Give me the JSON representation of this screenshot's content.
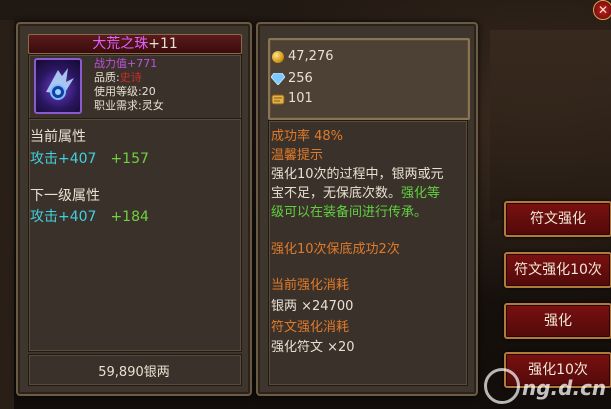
{
  "item": {
    "name": "大荒之珠",
    "level": "+11",
    "power": "战力值+771",
    "quality_label": "品质:",
    "quality_value": "史诗",
    "use_level": "使用等级:20",
    "class_req": "职业需求:灵女"
  },
  "current_attrs": {
    "title": "当前属性",
    "attack": "攻击+407",
    "bonus": "+157"
  },
  "next_attrs": {
    "title": "下一级属性",
    "attack": "攻击+407",
    "bonus": "+184"
  },
  "cost_silver": "59,890银两",
  "resources": {
    "gold": "47,276",
    "diamond": "256",
    "scroll": "101"
  },
  "info": {
    "success_rate": "成功率 48%",
    "tip_title": "温馨提示",
    "tip_line1": "强化10次的过程中，银两或元",
    "tip_line2a": "宝不足，无保底次数。",
    "tip_line2b": "强化等",
    "tip_line3": "级可以在装备间进行传承。",
    "guarantee": "强化10次保底成功2次",
    "consume_title": "当前强化消耗",
    "silver_cost": "银两 ×24700",
    "rune_title": "符文强化消耗",
    "rune_cost": "强化符文 ×20"
  },
  "buttons": {
    "rune_enhance": "符文强化",
    "rune_enhance_10": "符文强化10次",
    "enhance": "强化",
    "enhance_10": "强化10次"
  },
  "close": "✕",
  "watermark": "ng.d.cn",
  "colors": {
    "panel": "#3e352c",
    "button": "#6a0e0e",
    "orange_text": "#e07a2a",
    "green_text": "#60d040",
    "cyan_text": "#40d0e0",
    "epic": "#c050e0"
  }
}
